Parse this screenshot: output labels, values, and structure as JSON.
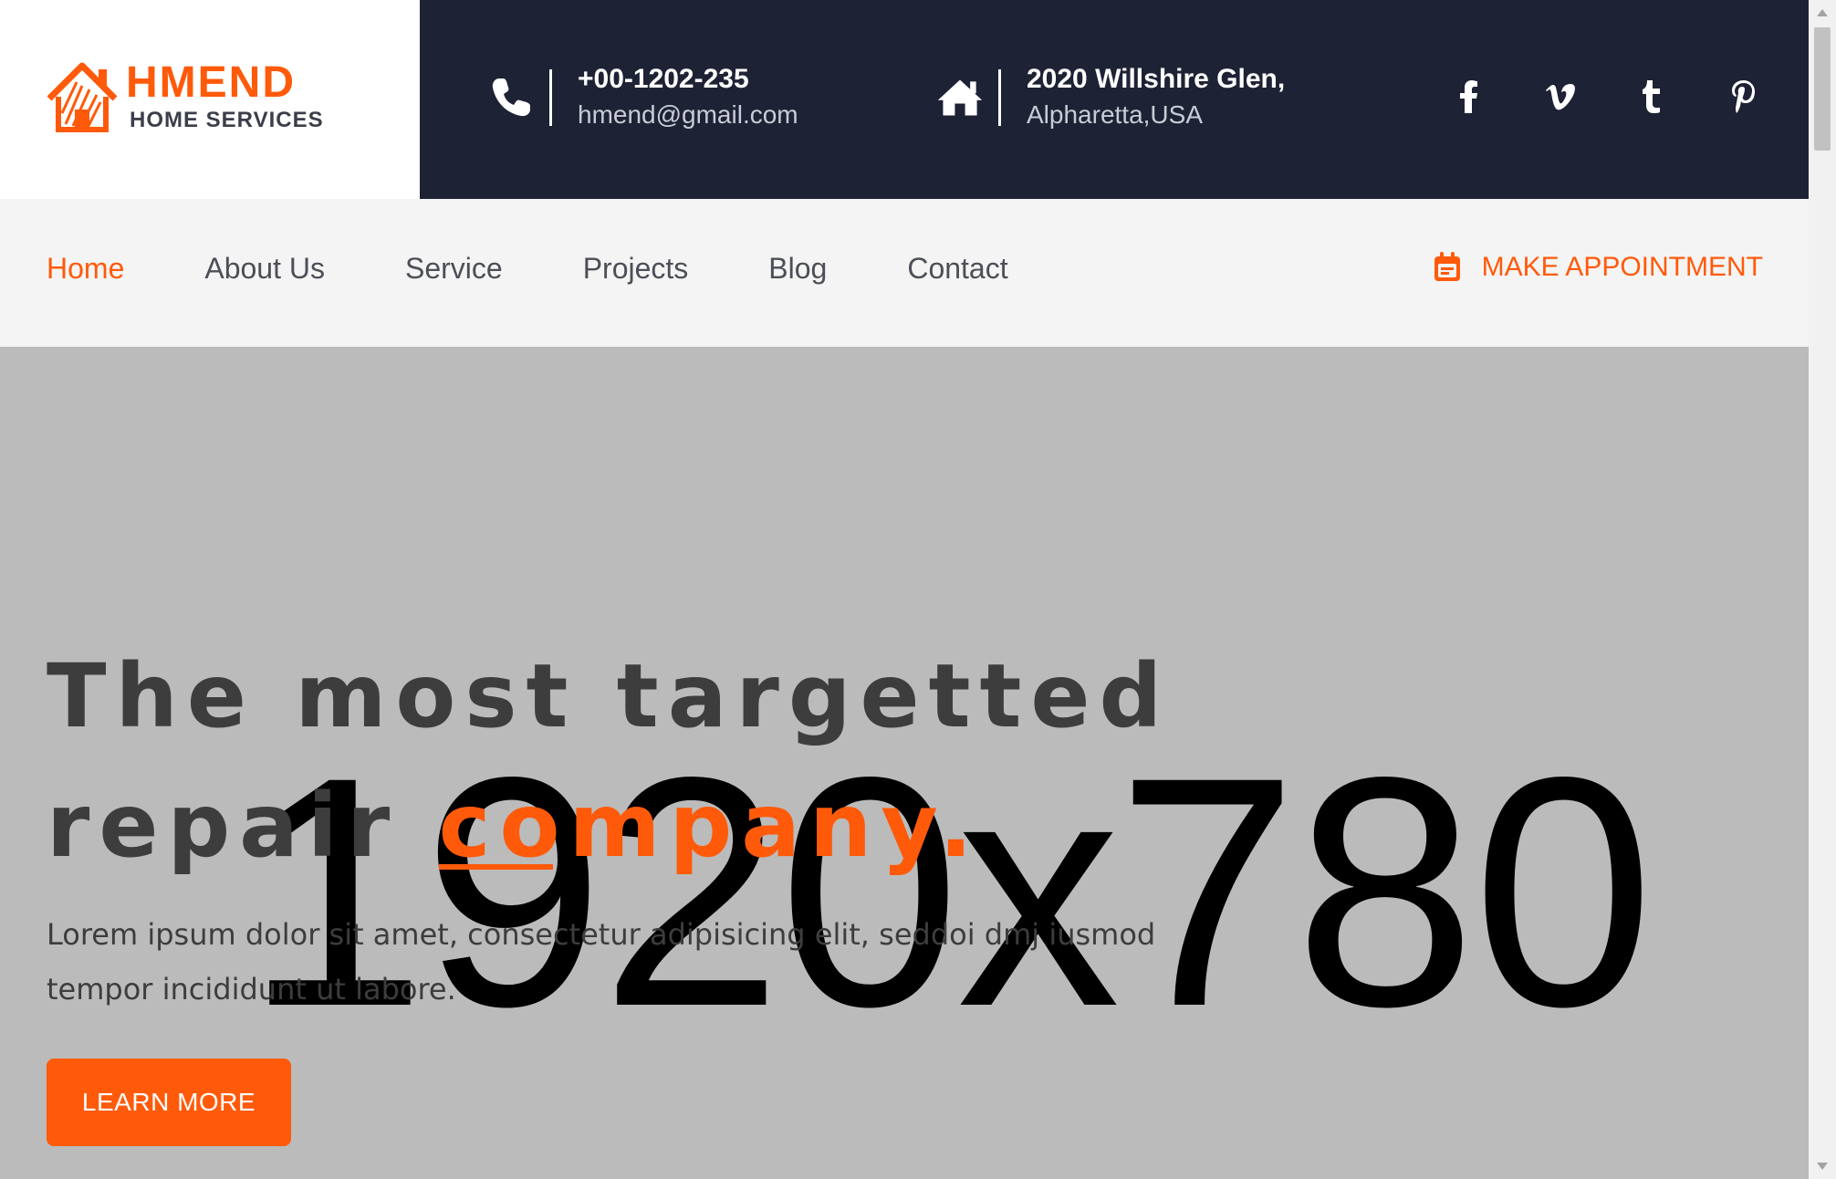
{
  "brand": {
    "name": "HMEND",
    "tagline": "HOME SERVICES"
  },
  "contact": {
    "phone": "+00-1202-235",
    "email": "hmend@gmail.com",
    "phone_icon": "phone-icon"
  },
  "address": {
    "line1": "2020 Willshire Glen,",
    "line2": "Alpharetta,USA",
    "icon": "home-icon"
  },
  "socials": [
    {
      "name": "facebook",
      "glyph": "f"
    },
    {
      "name": "vimeo",
      "glyph": "v"
    },
    {
      "name": "tumblr",
      "glyph": "t"
    },
    {
      "name": "pinterest",
      "glyph": "p"
    }
  ],
  "nav": {
    "items": [
      {
        "label": "Home",
        "active": true
      },
      {
        "label": "About Us",
        "active": false
      },
      {
        "label": "Service",
        "active": false
      },
      {
        "label": "Projects",
        "active": false
      },
      {
        "label": "Blog",
        "active": false
      },
      {
        "label": "Contact",
        "active": false
      }
    ],
    "appointment_label": "MAKE APPOINTMENT",
    "appointment_icon": "calendar-icon"
  },
  "hero": {
    "placeholder_text": "1920x780",
    "title_line1": "The most targetted",
    "title_line2_plain": "repair",
    "title_line2_accent": "company.",
    "description": "Lorem ipsum dolor sit amet, consectetur adipisicing elit, seddoi dmj iusmod tempor incididunt ut labore.",
    "button_label": "LEARN MORE"
  },
  "colors": {
    "accent": "#ff5a0a",
    "header_dark": "#1e2235",
    "nav_bg": "#f4f4f4",
    "hero_bg": "#bbbbbb",
    "text_dark": "#3d3d3d"
  }
}
